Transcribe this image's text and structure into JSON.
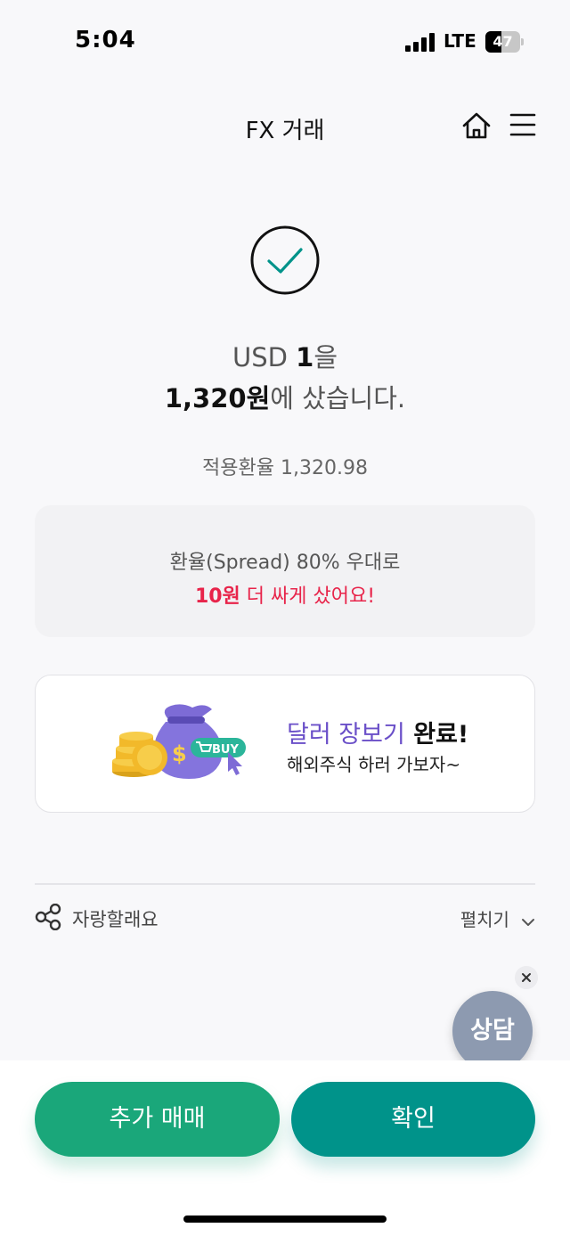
{
  "status_bar": {
    "time": "5:04",
    "network": "LTE",
    "battery": "47",
    "battery_level": 0.47
  },
  "nav": {
    "title": "FX 거래"
  },
  "result": {
    "line1_prefix": "USD ",
    "amount": "1",
    "line1_suffix": "을",
    "krw_amount": "1,320원",
    "line2_suffix": "에 샀습니다."
  },
  "applied_rate": "적용환율 1,320.98",
  "spread": {
    "line1": "환율(Spread) 80% 우대로",
    "saved_amount": "10원",
    "line2_suffix": " 더 싸게 샀어요!"
  },
  "promo": {
    "title_accent": "달러 장보기",
    "title_rest": " 완료!",
    "subtitle": "해외주식 하러 가보자~",
    "buy_tag": "BUY",
    "icons": [
      "money-bag-icon",
      "coin-stack-icon",
      "cart-icon",
      "cursor-icon"
    ]
  },
  "share": {
    "label": "자랑할래요",
    "expand": "펼치기"
  },
  "consult": {
    "label": "상담"
  },
  "buttons": {
    "more_trade": "추가 매매",
    "confirm": "확인"
  },
  "colors": {
    "check": "#00938a",
    "highlight_red": "#e8244a",
    "promo_purple": "#6a4fc8",
    "btn_more": "#1aa77a",
    "btn_confirm": "#00938a",
    "consult_bg": "#8d9ab0"
  }
}
